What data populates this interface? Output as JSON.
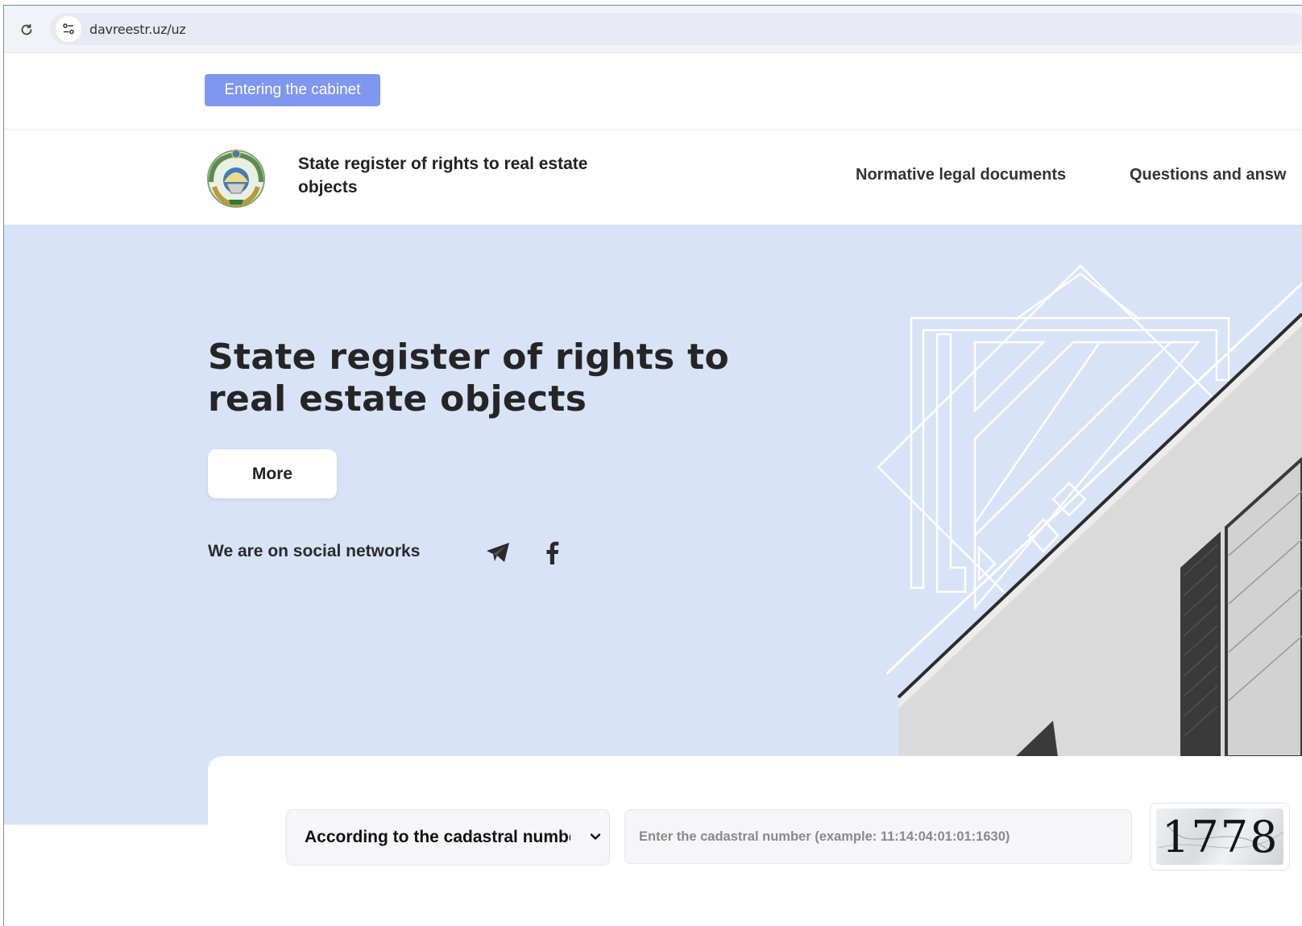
{
  "browser": {
    "url": "davreestr.uz/uz"
  },
  "top_bar": {
    "cabinet_label": "Entering the cabinet"
  },
  "header": {
    "site_title": "State register of rights to real estate objects",
    "nav": [
      {
        "label": "Normative legal documents"
      },
      {
        "label": "Questions and answ"
      }
    ]
  },
  "hero": {
    "title": "State register of rights to real estate objects",
    "more_label": "More",
    "social_label": "We are on social networks",
    "social_icons": [
      "telegram-icon",
      "facebook-icon"
    ]
  },
  "search": {
    "selected_option": "According to the cadastral number",
    "input_value": "",
    "input_placeholder": "Enter the cadastral number (example: 11:14:04:01:01:1630)",
    "captcha_text": "1778"
  },
  "colors": {
    "accent": "#7f97ee",
    "hero_bg": "#d8e3f7",
    "text_dark": "#252525"
  }
}
